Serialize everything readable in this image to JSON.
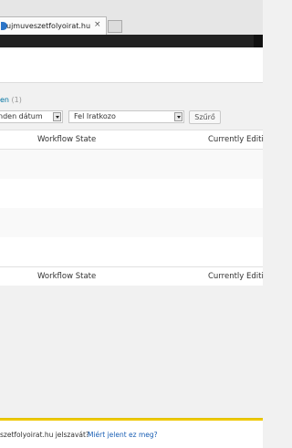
{
  "browser": {
    "tab_title": "ujmuveszetfolyoirat.hu",
    "tab_close": "×",
    "favicon": "site-favicon"
  },
  "subsubsub": {
    "link_fragment": "en",
    "count": "(1)"
  },
  "filters": {
    "date_value": "nden dátum",
    "type_value": "Fel Iratkozo",
    "filter_button": "Szűrő"
  },
  "table": {
    "columns": [
      "Workflow State",
      "Currently Editi"
    ],
    "footer_columns": [
      "Workflow State",
      "Currently Editi"
    ]
  },
  "notification": {
    "message": "szetfolyoirat.hu jelszavát?",
    "why_link": "Miért jelent ez meg?"
  }
}
